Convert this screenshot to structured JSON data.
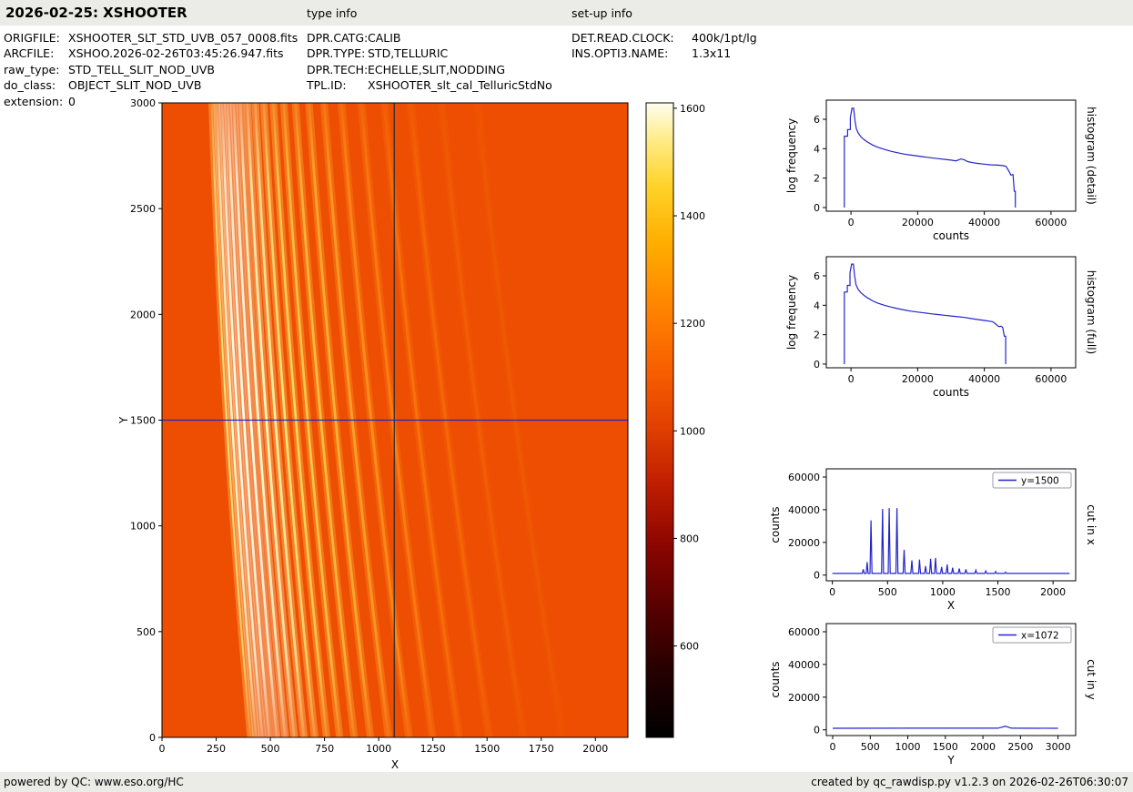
{
  "header": {
    "title": "2026-02-25: XSHOOTER",
    "type_info_label": "type info",
    "setup_info_label": "set-up info"
  },
  "meta": {
    "col1": [
      {
        "label": "ORIGFILE:",
        "value": "XSHOOTER_SLT_STD_UVB_057_0008.fits"
      },
      {
        "label": "ARCFILE:",
        "value": "XSHOO.2026-02-26T03:45:26.947.fits"
      },
      {
        "label": "raw_type:",
        "value": "STD_TELL_SLIT_NOD_UVB"
      },
      {
        "label": "do_class:",
        "value": "OBJECT_SLIT_NOD_UVB"
      },
      {
        "label": "extension:",
        "value": "0"
      }
    ],
    "col2": [
      {
        "label": "DPR.CATG:",
        "value": "CALIB"
      },
      {
        "label": "DPR.TYPE:",
        "value": "STD,TELLURIC"
      },
      {
        "label": "DPR.TECH:",
        "value": "ECHELLE,SLIT,NODDING"
      },
      {
        "label": "TPL.ID:",
        "value": "XSHOOTER_slt_cal_TelluricStdNo"
      }
    ],
    "col3": [
      {
        "label": "DET.READ.CLOCK:",
        "value": "400k/1pt/lg"
      },
      {
        "label": "INS.OPTI3.NAME:",
        "value": "1.3x11"
      }
    ]
  },
  "footer": {
    "left": "powered by QC: www.eso.org/HC",
    "right": "created by qc_rawdisp.py v1.2.3 on 2026-02-26T06:30:07"
  },
  "chart_data": [
    {
      "id": "main-image",
      "type": "heatmap",
      "xlabel": "X",
      "ylabel": "Y",
      "xlim": [
        0,
        2150
      ],
      "ylim": [
        0,
        3000
      ],
      "xticks": [
        0,
        250,
        500,
        750,
        1000,
        1250,
        1500,
        1750,
        2000
      ],
      "yticks": [
        0,
        500,
        1000,
        1500,
        2000,
        2500,
        3000
      ],
      "background_value": 1050,
      "background_color": "#ee4e02",
      "crosshair": {
        "x": 1072,
        "y": 1500,
        "x_color": "#2e2e2e",
        "y_color": "#2424cc"
      },
      "orders_note": "echelle spectral orders: [x_top, x_mid, x_bottom, core_width_px, color]",
      "orders": [
        [
          230,
          298,
          408,
          2.0,
          "#ffe27a"
        ],
        [
          253,
          323,
          434,
          2.4,
          "#fff9c8"
        ],
        [
          277,
          349,
          463,
          2.6,
          "#ffffe6"
        ],
        [
          303,
          378,
          495,
          2.7,
          "#ffffe8"
        ],
        [
          331,
          410,
          530,
          2.7,
          "#ffffe6"
        ],
        [
          361,
          444,
          568,
          2.7,
          "#fffcd0"
        ],
        [
          394,
          482,
          610,
          2.7,
          "#fff8ba"
        ],
        [
          430,
          523,
          655,
          2.7,
          "#ffef9c"
        ],
        [
          470,
          568,
          705,
          2.6,
          "#ffe478"
        ],
        [
          514,
          618,
          760,
          2.6,
          "#ffd75e"
        ],
        [
          562,
          672,
          820,
          2.6,
          "#ffca4c"
        ],
        [
          616,
          733,
          887,
          2.7,
          "#ffbf40"
        ],
        [
          678,
          801,
          962,
          2.8,
          "#ffb234"
        ],
        [
          748,
          878,
          1046,
          2.9,
          "#ffa028"
        ],
        [
          828,
          965,
          1140,
          3.0,
          "#ff8e1c"
        ],
        [
          920,
          1065,
          1248,
          3.1,
          "#fb7e12"
        ],
        [
          1026,
          1178,
          1370,
          3.3,
          "#f8710a"
        ],
        [
          1148,
          1308,
          1510,
          3.5,
          "#f56706"
        ],
        [
          1290,
          1458,
          1668,
          3.7,
          "#f25d04"
        ],
        [
          1455,
          1630,
          1848,
          3.9,
          "#f05803"
        ]
      ]
    },
    {
      "id": "colorbar",
      "type": "colorbar",
      "vmin": 430,
      "vmax": 1610,
      "ticks": [
        600,
        800,
        1000,
        1200,
        1400,
        1600
      ],
      "stops": [
        [
          0,
          "#000000"
        ],
        [
          0.1,
          "#240000"
        ],
        [
          0.2,
          "#550000"
        ],
        [
          0.3,
          "#8a0500"
        ],
        [
          0.4,
          "#c01e00"
        ],
        [
          0.5,
          "#e44400"
        ],
        [
          0.58,
          "#f85f00"
        ],
        [
          0.68,
          "#ff8500"
        ],
        [
          0.78,
          "#ffae00"
        ],
        [
          0.87,
          "#ffd32a"
        ],
        [
          0.94,
          "#ffeb84"
        ],
        [
          1,
          "#fffef0"
        ]
      ]
    },
    {
      "id": "hist-detail",
      "type": "line",
      "right_label": "histogram (detail)",
      "xlabel": "counts",
      "ylabel": "log frequency",
      "xlim": [
        -7400,
        67400
      ],
      "ylim": [
        -0.25,
        7.3
      ],
      "xticks": [
        0,
        20000,
        40000,
        60000
      ],
      "yticks": [
        0,
        2,
        4,
        6
      ],
      "color": "#2424cc",
      "points": [
        [
          -2000,
          0
        ],
        [
          -2000,
          4.85
        ],
        [
          -1000,
          4.85
        ],
        [
          -1000,
          5.3
        ],
        [
          -200,
          5.3
        ],
        [
          -200,
          6.1
        ],
        [
          300,
          6.75
        ],
        [
          800,
          6.75
        ],
        [
          1200,
          5.9
        ],
        [
          1600,
          5.35
        ],
        [
          2200,
          5.05
        ],
        [
          3000,
          4.8
        ],
        [
          4000,
          4.6
        ],
        [
          5000,
          4.45
        ],
        [
          6500,
          4.25
        ],
        [
          8000,
          4.1
        ],
        [
          10000,
          3.95
        ],
        [
          12000,
          3.82
        ],
        [
          14000,
          3.72
        ],
        [
          16000,
          3.63
        ],
        [
          18000,
          3.56
        ],
        [
          20000,
          3.5
        ],
        [
          22000,
          3.44
        ],
        [
          24000,
          3.38
        ],
        [
          26000,
          3.33
        ],
        [
          28000,
          3.28
        ],
        [
          30000,
          3.22
        ],
        [
          31500,
          3.17
        ],
        [
          33000,
          3.3
        ],
        [
          34000,
          3.24
        ],
        [
          35000,
          3.12
        ],
        [
          36500,
          3.05
        ],
        [
          38000,
          3.0
        ],
        [
          40000,
          2.95
        ],
        [
          42000,
          2.9
        ],
        [
          44000,
          2.88
        ],
        [
          45500,
          2.85
        ],
        [
          46500,
          2.8
        ],
        [
          47300,
          2.5
        ],
        [
          48000,
          2.2
        ],
        [
          48600,
          2.25
        ],
        [
          49000,
          1.1
        ],
        [
          49300,
          1.1
        ],
        [
          49300,
          0
        ]
      ]
    },
    {
      "id": "hist-full",
      "type": "line",
      "right_label": "histogram (full)",
      "xlabel": "counts",
      "ylabel": "log frequency",
      "xlim": [
        -7400,
        67400
      ],
      "ylim": [
        -0.25,
        7.3
      ],
      "xticks": [
        0,
        20000,
        40000,
        60000
      ],
      "yticks": [
        0,
        2,
        4,
        6
      ],
      "color": "#2424cc",
      "points": [
        [
          -2000,
          0
        ],
        [
          -2000,
          4.9
        ],
        [
          -1100,
          4.9
        ],
        [
          -1100,
          5.35
        ],
        [
          -300,
          5.35
        ],
        [
          -300,
          6.2
        ],
        [
          200,
          6.8
        ],
        [
          700,
          6.8
        ],
        [
          1100,
          6.0
        ],
        [
          1500,
          5.4
        ],
        [
          2100,
          5.1
        ],
        [
          3000,
          4.85
        ],
        [
          4000,
          4.65
        ],
        [
          5000,
          4.5
        ],
        [
          6500,
          4.3
        ],
        [
          8000,
          4.15
        ],
        [
          10000,
          4.0
        ],
        [
          12000,
          3.88
        ],
        [
          14000,
          3.77
        ],
        [
          16000,
          3.68
        ],
        [
          18000,
          3.6
        ],
        [
          20000,
          3.54
        ],
        [
          22000,
          3.48
        ],
        [
          24000,
          3.42
        ],
        [
          26000,
          3.37
        ],
        [
          28000,
          3.32
        ],
        [
          30000,
          3.27
        ],
        [
          32000,
          3.22
        ],
        [
          34000,
          3.17
        ],
        [
          36000,
          3.1
        ],
        [
          38000,
          3.03
        ],
        [
          40000,
          2.97
        ],
        [
          41500,
          2.92
        ],
        [
          42500,
          2.88
        ],
        [
          43300,
          2.75
        ],
        [
          44000,
          2.6
        ],
        [
          44500,
          2.55
        ],
        [
          45000,
          2.58
        ],
        [
          45500,
          2.5
        ],
        [
          46000,
          1.9
        ],
        [
          46400,
          1.9
        ],
        [
          46400,
          0
        ]
      ]
    },
    {
      "id": "cut-x",
      "type": "line",
      "right_label": "cut in x",
      "xlabel": "X",
      "ylabel": "counts",
      "legend": "y=1500",
      "xlim": [
        -55,
        2205
      ],
      "ylim": [
        -3500,
        65000
      ],
      "xticks": [
        0,
        500,
        1000,
        1500,
        2000
      ],
      "yticks": [
        0,
        20000,
        40000,
        60000
      ],
      "color": "#2424cc",
      "baseline": 1000,
      "xmax_data": 2150,
      "spikes": [
        [
          280,
          3500
        ],
        [
          315,
          8000
        ],
        [
          350,
          33500
        ],
        [
          455,
          40500
        ],
        [
          515,
          41000
        ],
        [
          585,
          41000
        ],
        [
          650,
          15500
        ],
        [
          720,
          9000
        ],
        [
          790,
          9500
        ],
        [
          845,
          5500
        ],
        [
          890,
          10000
        ],
        [
          935,
          10500
        ],
        [
          990,
          5000
        ],
        [
          1040,
          6500
        ],
        [
          1090,
          4500
        ],
        [
          1150,
          4000
        ],
        [
          1210,
          3500
        ],
        [
          1300,
          3000
        ],
        [
          1390,
          2500
        ],
        [
          1480,
          2200
        ],
        [
          1570,
          1800
        ]
      ]
    },
    {
      "id": "cut-y",
      "type": "line",
      "right_label": "cut in y",
      "xlabel": "Y",
      "ylabel": "counts",
      "legend": "x=1072",
      "xlim": [
        -85,
        3235
      ],
      "ylim": [
        -3500,
        65000
      ],
      "xticks": [
        0,
        500,
        1000,
        1500,
        2000,
        2500,
        3000
      ],
      "yticks": [
        0,
        20000,
        40000,
        60000
      ],
      "color": "#2424cc",
      "points": [
        [
          0,
          950
        ],
        [
          1000,
          1000
        ],
        [
          2200,
          1000
        ],
        [
          2300,
          2200
        ],
        [
          2380,
          1000
        ],
        [
          3000,
          950
        ]
      ]
    }
  ]
}
